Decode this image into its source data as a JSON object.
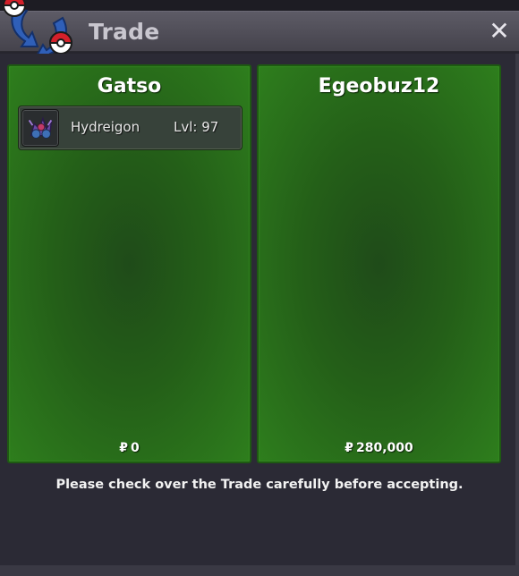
{
  "window": {
    "title": "Trade",
    "close_label": "✕"
  },
  "icons": {
    "logo": "trade-logo-icon",
    "close": "close-icon",
    "pokemon": "hydreigon-icon"
  },
  "left_panel": {
    "player": "Gatso",
    "currency_symbol": "₽",
    "money": "0",
    "items": [
      {
        "name": "Hydreigon",
        "level": "Lvl: 97"
      }
    ]
  },
  "right_panel": {
    "player": "Egeobuz12",
    "currency_symbol": "₽",
    "money": "280,000",
    "items": []
  },
  "notice": "Please check over the Trade carefully before accepting.",
  "colors": {
    "panel_green": "#2e7e1d",
    "title_bar": "#4e4c56",
    "background": "#2b2a35"
  }
}
